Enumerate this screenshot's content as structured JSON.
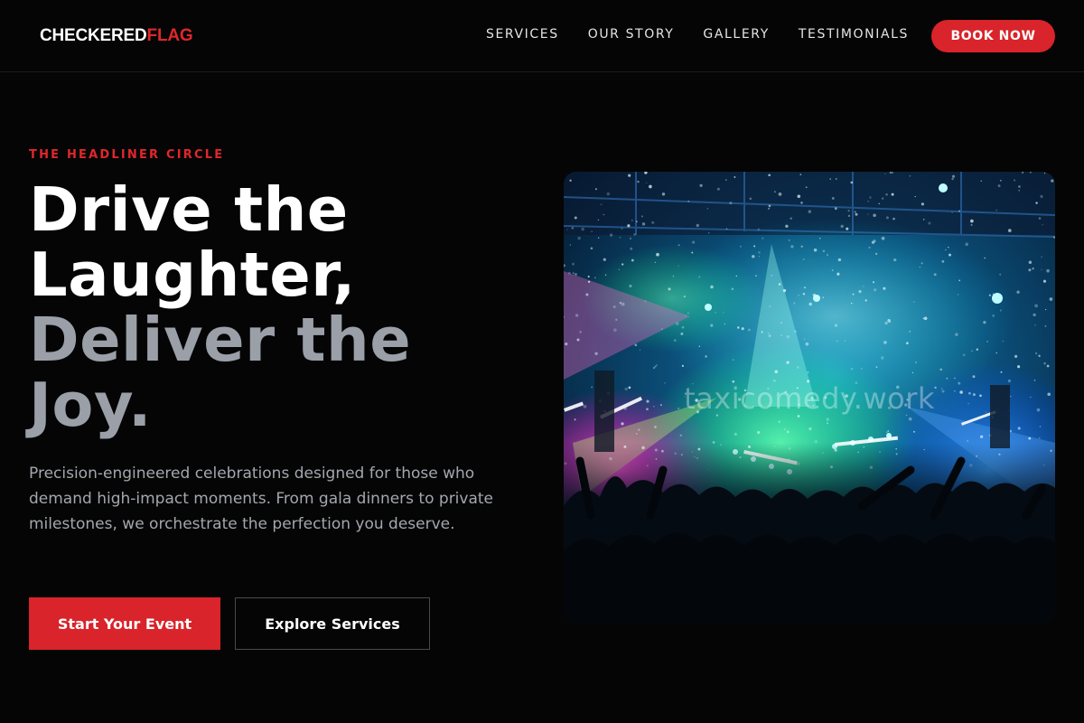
{
  "brand": {
    "name_main": "CHECKERED",
    "name_accent": "FLAG",
    "accent_color": "#e0272b"
  },
  "nav": {
    "links": [
      "SERVICES",
      "OUR STORY",
      "GALLERY",
      "TESTIMONIALS"
    ],
    "cta_label": "BOOK NOW"
  },
  "hero": {
    "eyebrow": "THE HEADLINER CIRCLE",
    "headline_lines": [
      "Drive the",
      "Laughter,",
      "Deliver the",
      "Joy."
    ],
    "description": "Precision-engineered celebrations designed for those who demand high-impact moments. From gala dinners to private milestones, we orchestrate the perfection you deserve.",
    "primary_button": "Start Your Event",
    "secondary_button": "Explore Services",
    "image_watermark": "taxicomedy.work",
    "image_subject": "concert crowd with colorful stage lights and confetti"
  },
  "colors": {
    "background": "#050505",
    "primary": "#d8242a",
    "headline_secondary": "#9a9fa8",
    "body_text": "#a3a7ae"
  }
}
